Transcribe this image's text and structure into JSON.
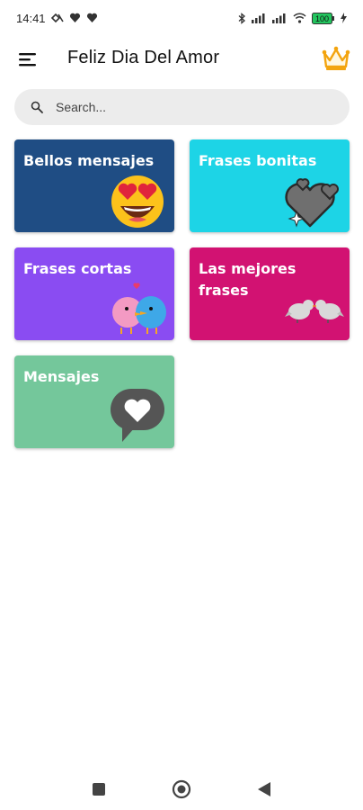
{
  "status_bar": {
    "time": "14:41",
    "battery": "100"
  },
  "app_bar": {
    "title": "Feliz Dia Del Amor"
  },
  "search": {
    "placeholder": "Search..."
  },
  "categories": [
    {
      "label": "Bellos mensajes",
      "color": "#1f4d84",
      "icon": "heart-eyes-emoji-icon"
    },
    {
      "label": "Frases bonitas",
      "color": "#1dd4e6",
      "icon": "hearts-sticker-icon"
    },
    {
      "label": "Frases cortas",
      "color": "#8a4cf2",
      "icon": "lovebirds-icon"
    },
    {
      "label": "Las mejores frases",
      "color": "#d21272",
      "icon": "kissing-birds-icon"
    },
    {
      "label": "Mensajes",
      "color": "#74c79b",
      "icon": "heart-speech-bubble-icon"
    }
  ],
  "nav_bar": {
    "icons": [
      "recents-square-icon",
      "home-circle-icon",
      "back-triangle-icon"
    ]
  }
}
